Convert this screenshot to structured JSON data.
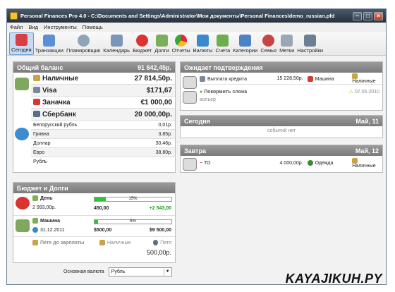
{
  "window": {
    "title": "Personal Finances Pro 4.0 - C:\\Documents and Settings\\Administrator\\Мои документы\\Personal Finances\\demo_russian.pfd"
  },
  "menu": [
    "Файл",
    "Вид",
    "Инструменты",
    "Помощь"
  ],
  "toolbar": [
    {
      "label": "Сегодня",
      "icon": "calendar-today-icon"
    },
    {
      "label": "Транзакции",
      "icon": "transactions-icon"
    },
    {
      "label": "Планировщик",
      "icon": "scheduler-icon"
    },
    {
      "label": "Календарь",
      "icon": "calendar-icon"
    },
    {
      "label": "Бюджет",
      "icon": "piggy-bank-icon"
    },
    {
      "label": "Долги",
      "icon": "debts-icon"
    },
    {
      "label": "Отчеты",
      "icon": "pie-chart-icon"
    },
    {
      "label": "Валюты",
      "icon": "currency-icon"
    },
    {
      "label": "Счета",
      "icon": "accounts-icon"
    },
    {
      "label": "Категории",
      "icon": "categories-icon"
    },
    {
      "label": "Семья",
      "icon": "family-icon"
    },
    {
      "label": "Метки",
      "icon": "tags-icon"
    },
    {
      "label": "Настройки",
      "icon": "settings-icon"
    }
  ],
  "balance": {
    "title": "Общий баланс",
    "total": "91 842,45р.",
    "accounts": [
      {
        "name": "Наличные",
        "value": "27 814,50р."
      },
      {
        "name": "Visa",
        "value": "$171,67"
      },
      {
        "name": "Заначка",
        "value": "€1 000,00"
      },
      {
        "name": "Сбербанк",
        "value": "20 000,00р."
      }
    ],
    "currencies": [
      {
        "name": "Белорусский рубль",
        "value": "0,01р."
      },
      {
        "name": "Гривна",
        "value": "3,85р."
      },
      {
        "name": "Доллар",
        "value": "30,46р."
      },
      {
        "name": "Евро",
        "value": "38,80р."
      },
      {
        "name": "Рубль",
        "value": ""
      }
    ]
  },
  "budget": {
    "title": "Бюджет и Долги",
    "day": {
      "name": "День",
      "amount": "2 993,00р.",
      "progress": 0.15,
      "percent": "15%",
      "spent": "450,00",
      "left": "+2 543,00"
    },
    "car": {
      "name": "Машина",
      "date": "31.12.2011",
      "progress": 0.05,
      "percent": "5%",
      "spent": "$500,00",
      "total": "$9 500,00"
    },
    "debt": {
      "name": "Пете до зарплаты",
      "account": "Наличные",
      "person": "Петя",
      "amount": "500,00р."
    }
  },
  "currency_select": {
    "label": "Основная валюта",
    "value": "Рубль"
  },
  "pending": {
    "title": "Ожидает подтверждения",
    "items": [
      {
        "name": "Выплата кредита",
        "amount": "15 228,50р.",
        "category": "Машина",
        "account": "Наличные"
      }
    ],
    "task": {
      "name": "Покормить слона",
      "sub": "вольер",
      "date": "07.05.2010"
    }
  },
  "today": {
    "title": "Сегодня",
    "date": "Май, 11",
    "empty": "событий нет"
  },
  "tomorrow": {
    "title": "Завтра",
    "date": "Май, 12",
    "item": {
      "name": "ТО",
      "amount": "4 000,00р.",
      "category": "Одежда",
      "account": "Наличные"
    }
  },
  "watermark": "KAYAJIKUH.PY",
  "colors": {
    "panel_header": "#8c8c8c",
    "progress": "#2fbf3a",
    "active_tab": "#c7daf2"
  }
}
